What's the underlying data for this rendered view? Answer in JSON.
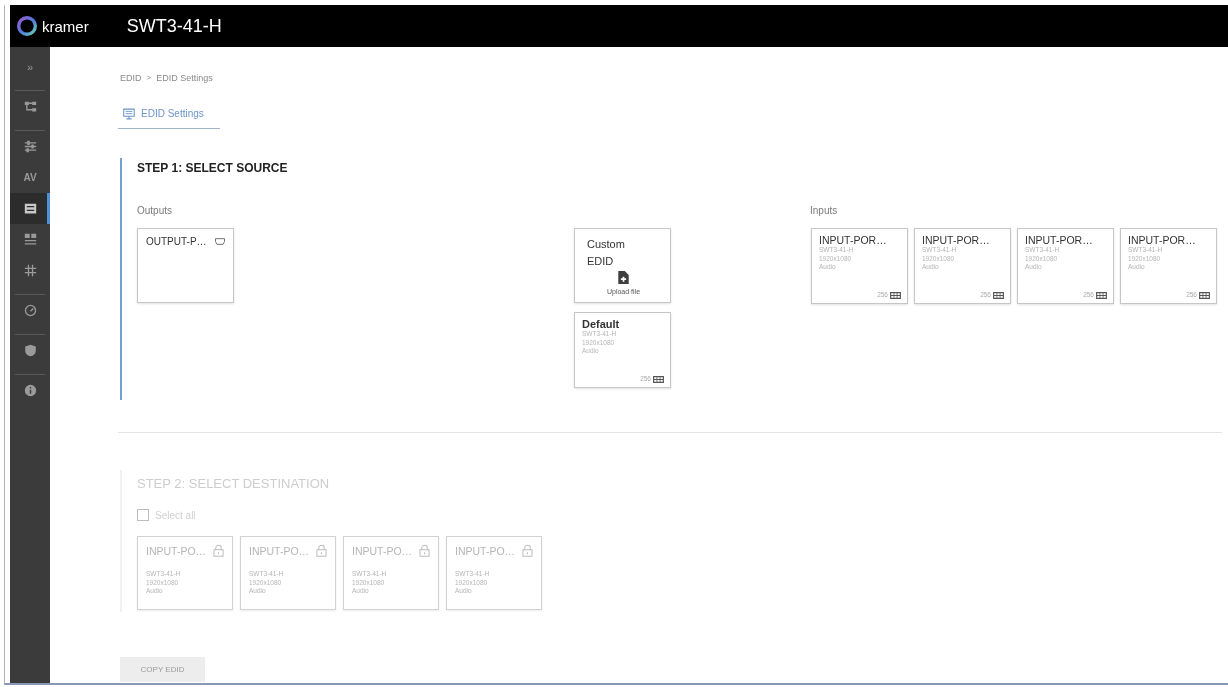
{
  "header": {
    "brand": "kramer",
    "device": "SWT3-41-H"
  },
  "sidebar": {
    "groups": [
      {
        "items": [
          {
            "kind": "text",
            "label": "»",
            "selected": false
          }
        ]
      },
      {
        "items": [
          {
            "kind": "icon",
            "selected": false
          }
        ]
      },
      {
        "items": [
          {
            "kind": "icon",
            "selected": false
          },
          {
            "kind": "text",
            "label": "AV",
            "selected": false
          },
          {
            "kind": "icon",
            "selected": true
          },
          {
            "kind": "icon",
            "selected": false
          },
          {
            "kind": "icon",
            "selected": false
          }
        ]
      },
      {
        "items": [
          {
            "kind": "icon",
            "selected": false
          }
        ]
      },
      {
        "items": [
          {
            "kind": "icon",
            "selected": false
          }
        ]
      },
      {
        "items": [
          {
            "kind": "icon",
            "selected": false
          }
        ]
      }
    ]
  },
  "breadcrumb": {
    "items": [
      "EDID",
      "EDID Settings"
    ],
    "separator": ">"
  },
  "tabs": [
    {
      "label": "EDID Settings",
      "selected": true
    }
  ],
  "step1": {
    "title": "STEP 1: SELECT SOURCE",
    "outputs_label": "Outputs",
    "outputs": [
      {
        "name": "OUTPUT-P…",
        "selected": false
      }
    ],
    "sources": [
      {
        "kind": "upload",
        "title": "Custom EDID",
        "action": "Upload file",
        "selected": false
      },
      {
        "kind": "edid",
        "name": "Default",
        "lines": [
          "SWT3-41-H",
          "1920x1080",
          "Audio"
        ],
        "size": "256",
        "selected": false
      }
    ],
    "inputs_label": "Inputs",
    "inputs": [
      {
        "name": "INPUT-POR…",
        "lines": [
          "SWT3-41-H",
          "1920x1080",
          "Audio"
        ],
        "size": "256",
        "selected": false
      },
      {
        "name": "INPUT-POR…",
        "lines": [
          "SWT3-41-H",
          "1920x1080",
          "Audio"
        ],
        "size": "256",
        "selected": false
      },
      {
        "name": "INPUT-POR…",
        "lines": [
          "SWT3-41-H",
          "1920x1080",
          "Audio"
        ],
        "size": "256",
        "selected": false
      },
      {
        "name": "INPUT-POR…",
        "lines": [
          "SWT3-41-H",
          "1920x1080",
          "Audio"
        ],
        "size": "256",
        "selected": false
      }
    ]
  },
  "step2": {
    "title": "STEP 2: SELECT DESTINATION",
    "disabled": true,
    "select_all": {
      "label": "Select all",
      "checked": false
    },
    "destinations": [
      {
        "name": "INPUT-PO…",
        "locked": true,
        "lines": [
          "SWT3-41-H",
          "1920x1080",
          "Audio"
        ],
        "selected": false
      },
      {
        "name": "INPUT-PO…",
        "locked": true,
        "lines": [
          "SWT3-41-H",
          "1920x1080",
          "Audio"
        ],
        "selected": false
      },
      {
        "name": "INPUT-PO…",
        "locked": true,
        "lines": [
          "SWT3-41-H",
          "1920x1080",
          "Audio"
        ],
        "selected": false
      },
      {
        "name": "INPUT-PO…",
        "locked": true,
        "lines": [
          "SWT3-41-H",
          "1920x1080",
          "Audio"
        ],
        "selected": false
      }
    ]
  },
  "copy_button": {
    "label": "COPY EDID",
    "disabled": true
  }
}
